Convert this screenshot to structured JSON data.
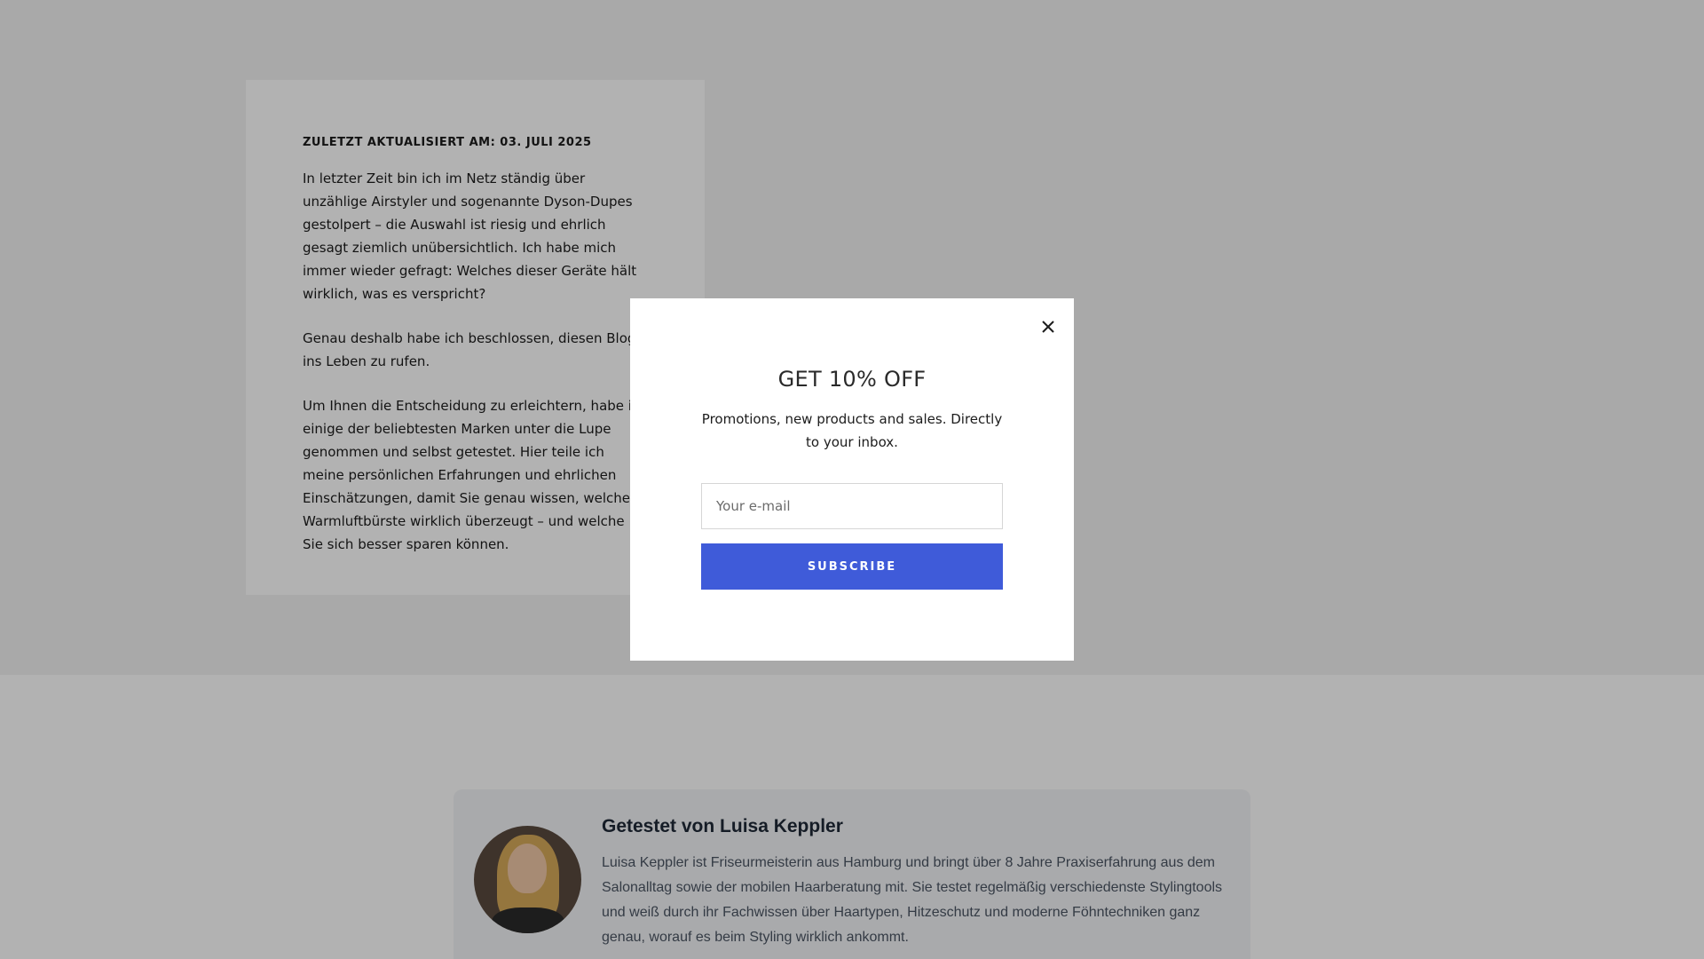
{
  "article": {
    "updated_label": "ZULETZT AKTUALISIERT AM: 03. JULI 2025",
    "paragraphs": [
      "In letzter Zeit bin ich im Netz ständig über unzählige Airstyler und sogenannte Dyson-Dupes gestolpert – die Auswahl ist riesig und ehrlich gesagt ziemlich unübersichtlich. Ich habe mich immer wieder gefragt: Welches dieser Geräte hält wirklich, was es verspricht?",
      "Genau deshalb habe ich beschlossen, diesen Blog ins Leben zu rufen.",
      "Um Ihnen die Entscheidung zu erleichtern, habe ich einige der beliebtesten Marken unter die Lupe genommen und selbst getestet. Hier teile ich meine persönlichen Erfahrungen und ehrlichen Einschätzungen, damit Sie genau wissen, welche Warmluftbürste wirklich überzeugt – und welche Sie sich besser sparen können."
    ]
  },
  "author": {
    "name": "Getestet von Luisa Keppler",
    "bio": "Luisa Keppler ist Friseurmeisterin aus Hamburg und bringt über 8 Jahre Praxiserfahrung aus dem Salonalltag sowie der mobilen Haarberatung mit. Sie testet regelmäßig verschiedenste Stylingtools und weiß durch ihr Fachwissen über Haartypen, Hitzeschutz und moderne Föhntechniken ganz genau, worauf es beim Styling wirklich ankommt.",
    "avatar_icon": "portrait-photo"
  },
  "popup": {
    "title": "GET 10% OFF",
    "text": "Promotions, new products and sales. Directly to your inbox.",
    "email_placeholder": "Your e-mail",
    "email_value": "",
    "subscribe_label": "SUBSCRIBE",
    "close_icon": "close-icon"
  },
  "colors": {
    "accent": "#3f5bd9",
    "overlay": "rgba(0,0,0,0.30)",
    "hero_background": "#f2f2f2",
    "author_card_background": "#f3f4f6"
  }
}
